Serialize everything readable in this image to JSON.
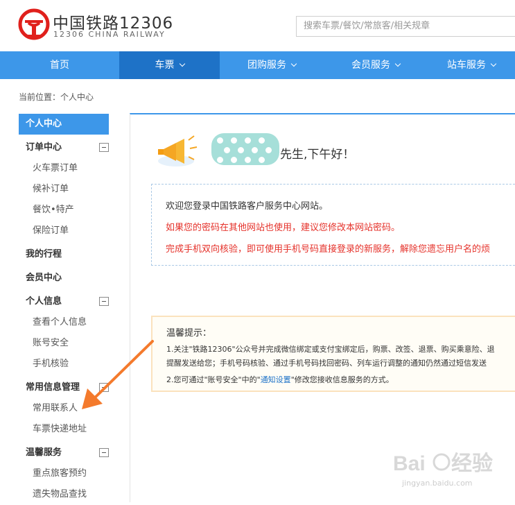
{
  "header": {
    "brand_cn": "中国铁路12306",
    "brand_en": "12306 CHINA RAILWAY",
    "search_placeholder": "搜索车票/餐饮/常旅客/相关规章"
  },
  "nav": {
    "items": [
      {
        "label": "首页",
        "has_caret": false
      },
      {
        "label": "车票",
        "has_caret": true
      },
      {
        "label": "团购服务",
        "has_caret": true
      },
      {
        "label": "会员服务",
        "has_caret": true
      },
      {
        "label": "站车服务",
        "has_caret": true
      }
    ],
    "active": "车票"
  },
  "breadcrumb": "当前位置：个人中心",
  "sidebar": {
    "title": "个人中心",
    "order_center": "订单中心",
    "train_orders": "火车票订单",
    "waitlist_orders": "候补订单",
    "catering": "餐饮•特产",
    "insurance": "保险订单",
    "my_trips": "我的行程",
    "member_center": "会员中心",
    "personal_info": "个人信息",
    "view_info": "查看个人信息",
    "account_security": "账号安全",
    "phone_verify": "手机核验",
    "common_info": "常用信息管理",
    "contacts": "常用联系人",
    "delivery_address": "车票快递地址",
    "tips_service": "温馨服务",
    "priority_passenger": "重点旅客预约",
    "lost_items": "遗失物品查找"
  },
  "main": {
    "greeting": "先生,下午好！",
    "welcome_line1": "欢迎您登录中国铁路客户服务中心网站。",
    "welcome_line2": "如果您的密码在其他网站也使用，建议您修改本网站密码。",
    "welcome_line3": "完成手机双向核验，即可使用手机号码直接登录的新服务，解除您遗忘用户名的烦",
    "tip_title": "温馨提示：",
    "tip1a": "1.关注\"铁路12306\"公众号并完成微信绑定或支付宝绑定后，购票、改签、退票、购买乘意险、退",
    "tip1b": "提醒发送给您；手机号码核验、通过手机号码找回密码、列车运行调整的通知仍然通过短信发送",
    "tip2_pre": "2.您可通过\"账号安全\"中的\"",
    "tip2_link": "通知设置",
    "tip2_post": "\"修改您接收信息服务的方式。"
  },
  "colors": {
    "primary": "#3d97e9",
    "nav_active": "#1e72c7",
    "warning_text": "#e5312a",
    "arrow": "#f47a2c",
    "tip_border": "#fbe2bd"
  },
  "watermark": {
    "text": "jingyan.baidu.com"
  }
}
